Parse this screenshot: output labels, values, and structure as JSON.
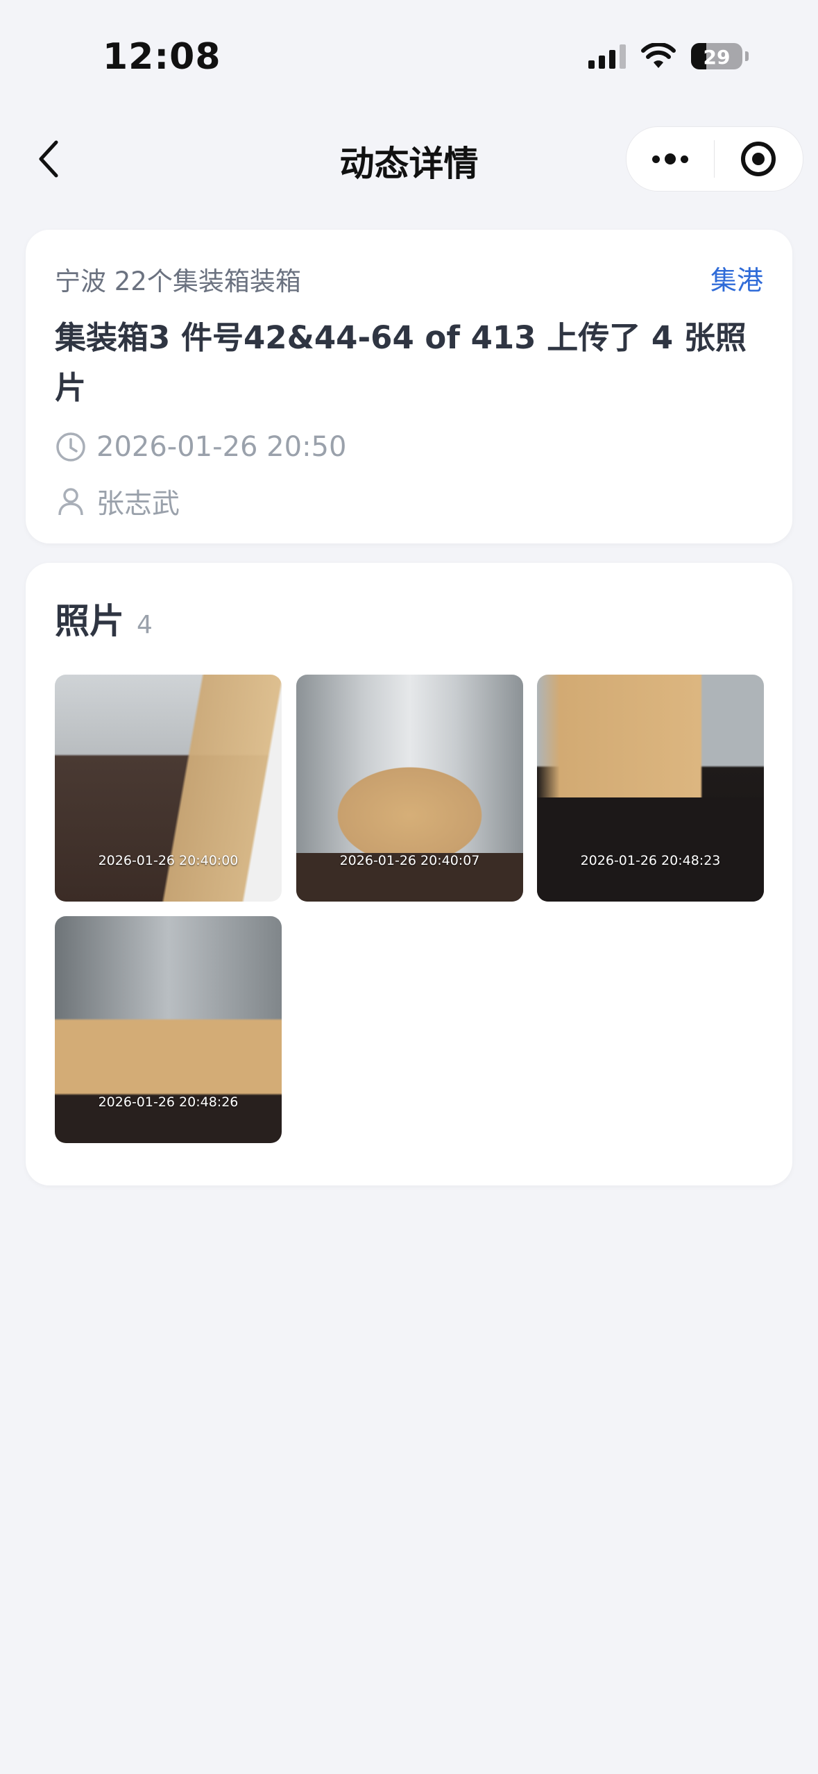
{
  "status_bar": {
    "time": "12:08",
    "battery": "29"
  },
  "nav": {
    "title": "动态详情"
  },
  "event": {
    "project": "宁波 22个集装箱装箱",
    "tag": "集港",
    "headline": "集装箱3 件号42&44-64 of 413 上传了 4 张照片",
    "datetime": "2026-01-26 20:50",
    "user": "张志武"
  },
  "photos": {
    "title": "照片",
    "count": "4",
    "items": [
      {
        "timestamp": "2026-01-26 20:40:00"
      },
      {
        "timestamp": "2026-01-26 20:40:07"
      },
      {
        "timestamp": "2026-01-26 20:48:23"
      },
      {
        "timestamp": "2026-01-26 20:48:26"
      }
    ]
  },
  "colors": {
    "accent": "#2f6bd8",
    "background": "#f3f4f8",
    "text": "#2f3542",
    "muted": "#9aa1ab"
  },
  "icons": [
    "back-icon",
    "more-icon",
    "record-icon",
    "clock-icon",
    "user-icon",
    "signal-icon",
    "wifi-icon",
    "battery-icon"
  ]
}
